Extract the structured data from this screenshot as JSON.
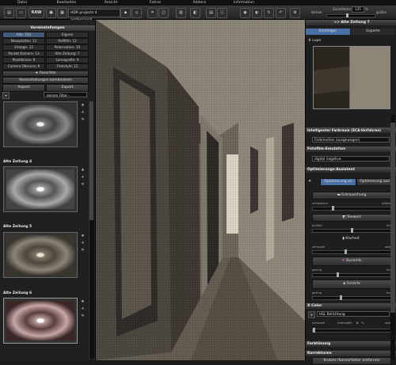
{
  "menu": [
    "Datei",
    "Bearbeiten",
    "Ansicht",
    "Extras",
    "Addons",
    "Information"
  ],
  "toolbar": {
    "raw_label": "RAW",
    "project_select": "HDR projects 4 professional",
    "zoom_small_label": "kleiner",
    "zoom_factor_label": "Zoomfaktor",
    "zoom_value": "125",
    "zoom_unit": "%",
    "zoom_large_label": "größer"
  },
  "left": {
    "header": "Voreinstellungen",
    "categories": [
      "Alle: 102",
      "Eigene",
      "Neosplatter: 13",
      "Rollfilm: 12",
      "Vintage: 12",
      "Polarisation: 10",
      "Pocket Kamera: 13",
      "Alte Zeitung: 7",
      "Plastiklinse: 8",
      "Lomografie: 9",
      "Camera Obscura: 6",
      "Freestyle: 12"
    ],
    "favorites_label": "Favoriten",
    "combine_label": "Voreinstellungen kombinieren",
    "import_label": "Import",
    "export_label": "Export",
    "filter_select": "-keinen Filter -",
    "thumbs": [
      "Alte Zeitung 4",
      "Alte Zeitung 5",
      "Alte Zeitung 6"
    ]
  },
  "right": {
    "header": ">> Alte Zeitung 7",
    "tab_beginner": "Einsteiger",
    "tab_expert": "Experte",
    "loupe_label": "Lupe",
    "intel_header": "Intelligenter Farbraum (SCA-Verfahren)",
    "intel_select": "Farbmedian (ausgewogen)",
    "photo_header": "Fotofilm-Emulation",
    "photo_select": "digital negative",
    "opt_header": "Optimierungs-Assistent",
    "opt_on": "Optimierung an",
    "opt_off": "Optimierung aus",
    "denoise_label": "Entrauschung",
    "weaker": "schwächer",
    "stronger": "stärker",
    "tone_label": "Tonwert",
    "dark": "dunkel",
    "bright": "hell",
    "clarity_label": "Klarheit",
    "weak": "schwach",
    "strong": "stark",
    "dynamic_label": "Dynamik",
    "low": "gering",
    "high": "hoch",
    "sharp_label": "Schärfe",
    "xcolor_header": "X Color",
    "xcolor_select": "HSL Belichtung",
    "intensity_label": "Intensität",
    "intensity_value": "0",
    "intensity_unit": "%",
    "tint_header": "Farbtönung",
    "correct_header": "Korrekturen",
    "scratch_label": "Kratzer-/Sensorfehler entfernen"
  },
  "colors": {
    "accent": "#4a6fa5",
    "image_sepia": "#5b554c"
  }
}
